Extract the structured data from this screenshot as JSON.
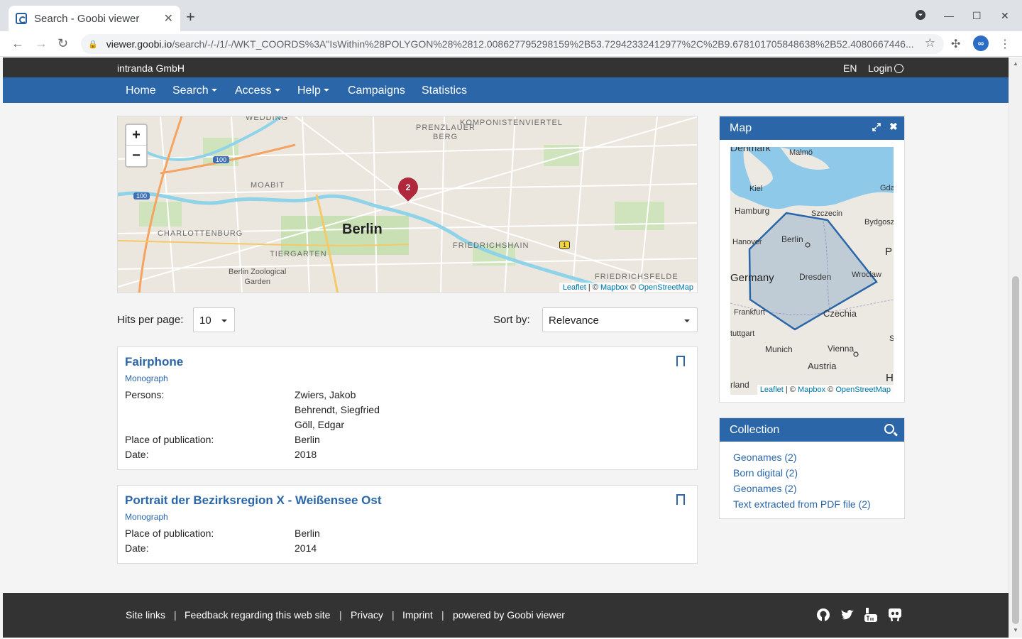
{
  "browser": {
    "tab_title": "Search - Goobi viewer",
    "url_host": "viewer.goobi.io",
    "url_path": "/search/-/-/1/-/WKT_COORDS%3A\"IsWithin%28POLYGON%28%2812.008627795298159%2B53.72942332412977%2C%2B9.678101705848638%2B52.4080667446..."
  },
  "topbar": {
    "org": "intranda GmbH",
    "lang": "EN",
    "login": "Login"
  },
  "nav": {
    "home": "Home",
    "search": "Search",
    "access": "Access",
    "help": "Help",
    "campaigns": "Campaigns",
    "statistics": "Statistics"
  },
  "map": {
    "zoom_in": "+",
    "zoom_out": "−",
    "marker_count": "2",
    "labels": {
      "wedding": "WEDDING",
      "komponistenviertel": "KOMPONISTENVIERTEL",
      "prenzlauer_1": "PRENZLAUER",
      "prenzlauer_2": "BERG",
      "moabit": "MOABIT",
      "berlin": "Berlin",
      "charlottenburg": "CHARLOTTENBURG",
      "tiergarten": "TIERGARTEN",
      "friedrichshain": "FRIEDRICHSHAIN",
      "friedrichsfelde": "FRIEDRICHSFELDE",
      "zoo_1": "Berlin Zoological",
      "zoo_2": "Garden",
      "road_100a": "100",
      "road_100b": "100",
      "road_1": "1"
    },
    "attribution": {
      "leaflet": "Leaflet",
      "sep": " | © ",
      "mapbox": "Mapbox",
      "osm_prefix": " © ",
      "osm": "OpenStreetMap"
    }
  },
  "controls": {
    "hits_label": "Hits per page:",
    "hits_value": "10",
    "sort_label": "Sort by:",
    "sort_value": "Relevance"
  },
  "results": [
    {
      "title": "Fairphone",
      "type": "Monograph",
      "persons_label": "Persons:",
      "persons": [
        "Zwiers, Jakob",
        "Behrendt, Siegfried",
        "Göll, Edgar"
      ],
      "place_label": "Place of publication:",
      "place": "Berlin",
      "date_label": "Date:",
      "date": "2018"
    },
    {
      "title": "Portrait der Bezirksregion X - Weißensee Ost",
      "type": "Monograph",
      "place_label": "Place of publication:",
      "place": "Berlin",
      "date_label": "Date:",
      "date": "2014"
    }
  ],
  "map_widget": {
    "title": "Map",
    "labels": {
      "denmark": "Denmark",
      "malmo": "Malmö",
      "kiel": "Kiel",
      "gda": "Gda",
      "hamburg": "Hamburg",
      "szczecin": "Szczecin",
      "bydgosz": "Bydgosz",
      "hanover": "Hanover",
      "berlin": "Berlin",
      "p": "P",
      "germany": "Germany",
      "dresden": "Dresden",
      "wroclaw": "Wrocław",
      "frankfurt": "Frankfurt",
      "czechia": "Czechia",
      "stuttgart": "tuttgart",
      "s": "S",
      "munich": "Munich",
      "vienna": "Vienna",
      "austria": "Austria",
      "land": "rland",
      "h": "H"
    }
  },
  "collection": {
    "title": "Collection",
    "items": [
      "Geonames (2)",
      "Born digital (2)",
      "Geonames (2)",
      "Text extracted from PDF file (2)"
    ]
  },
  "footer": {
    "site_links": "Site links",
    "feedback": "Feedback regarding this web site",
    "privacy": "Privacy",
    "imprint": "Imprint",
    "powered": "powered by Goobi viewer",
    "sep": "|"
  },
  "colors": {
    "brand": "#2b66a8",
    "dark": "#333333",
    "marker": "#b0283b"
  }
}
